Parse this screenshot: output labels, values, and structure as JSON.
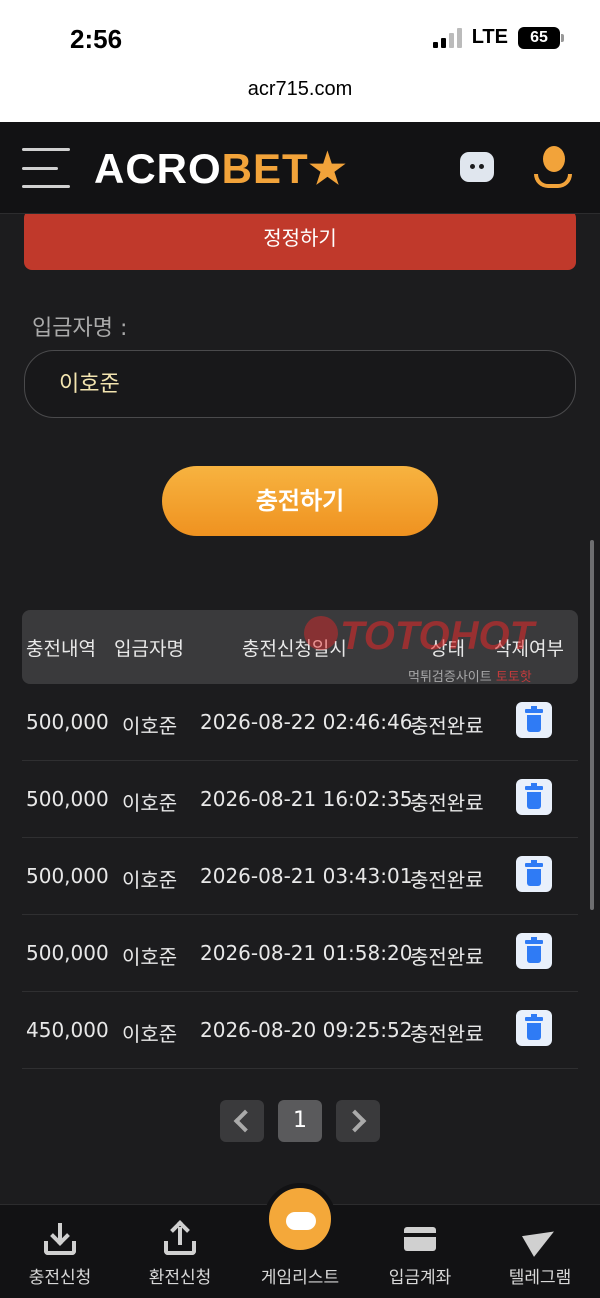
{
  "status_bar": {
    "time": "2:56",
    "network": "LTE",
    "battery": "65"
  },
  "browser": {
    "url": "acr715.com"
  },
  "header": {
    "logo_part1": "ACRO",
    "logo_part2": "BET★"
  },
  "form": {
    "edit_button": "정정하기",
    "depositor_label": "입금자명 :",
    "depositor_value": "이호준",
    "charge_button": "충전하기"
  },
  "table": {
    "columns": [
      "충전내역",
      "입금자명",
      "충전신청일시",
      "상태",
      "삭제여부"
    ],
    "rows": [
      {
        "amount": "500,000",
        "name": "이호준",
        "datetime": "2026-08-22 02:46:46",
        "status": "충전완료"
      },
      {
        "amount": "500,000",
        "name": "이호준",
        "datetime": "2026-08-21 16:02:35",
        "status": "충전완료"
      },
      {
        "amount": "500,000",
        "name": "이호준",
        "datetime": "2026-08-21 03:43:01",
        "status": "충전완료"
      },
      {
        "amount": "500,000",
        "name": "이호준",
        "datetime": "2026-08-21 01:58:20",
        "status": "충전완료"
      },
      {
        "amount": "450,000",
        "name": "이호준",
        "datetime": "2026-08-20 09:25:52",
        "status": "충전완료"
      }
    ]
  },
  "pagination": {
    "current": "1"
  },
  "watermark": {
    "brand": "TOTOHOT",
    "sub1": "먹튀검증사이트",
    "sub2": "토토핫"
  },
  "bottom_nav": [
    {
      "label": "충전신청",
      "icon": "download-icon"
    },
    {
      "label": "환전신청",
      "icon": "upload-icon"
    },
    {
      "label": "게임리스트",
      "icon": "gamepad-icon"
    },
    {
      "label": "입금계좌",
      "icon": "card-icon"
    },
    {
      "label": "텔레그램",
      "icon": "telegram-icon"
    }
  ],
  "colors": {
    "accent": "#f2a33a",
    "danger": "#c0392b",
    "trash": "#2f7bf5"
  }
}
